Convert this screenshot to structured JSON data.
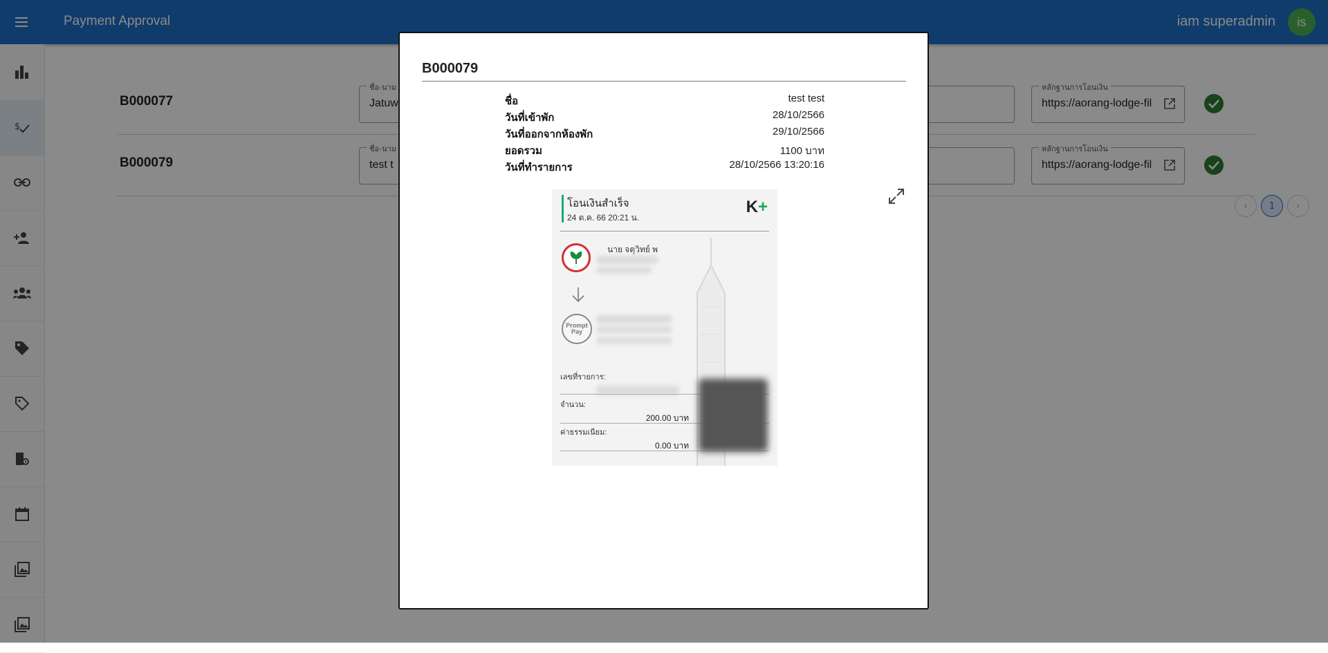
{
  "appbar": {
    "title": "Payment Approval",
    "user_name": "iam superadmin",
    "avatar_initials": "is"
  },
  "sidebar": {
    "items": [
      {
        "icon": "bar-chart-icon",
        "active": false
      },
      {
        "icon": "currency-check-icon",
        "active": true
      },
      {
        "icon": "link-icon",
        "active": false
      },
      {
        "icon": "add-person-icon",
        "active": false
      },
      {
        "icon": "groups-icon",
        "active": false
      },
      {
        "icon": "tag-icon",
        "active": false
      },
      {
        "icon": "tag-outline-icon",
        "active": false
      },
      {
        "icon": "building-settings-icon",
        "active": false
      },
      {
        "icon": "calendar-icon",
        "active": false
      },
      {
        "icon": "image-icon",
        "active": false
      },
      {
        "icon": "image-icon",
        "active": false
      }
    ]
  },
  "rows": [
    {
      "booking_id": "B000077",
      "name_label": "ชื่อ-นาม",
      "name_value": "Jatuw",
      "proof_label": "หลักฐานการโอนเงิน",
      "proof_value": "https://aorang-lodge-fil"
    },
    {
      "booking_id": "B000079",
      "name_label": "ชื่อ-นาม",
      "name_value": "test t",
      "proof_label": "หลักฐานการโอนเงิน",
      "proof_value": "https://aorang-lodge-fil"
    }
  ],
  "pagination": {
    "current_page": "1"
  },
  "dialog": {
    "title": "B000079",
    "details": [
      {
        "label": "ชื่อ",
        "value": "test test"
      },
      {
        "label": "วันที่เข้าพัก",
        "value": "28/10/2566"
      },
      {
        "label": "วันที่ออกจากห้องพัก",
        "value": "29/10/2566"
      },
      {
        "label": "ยอดรวม",
        "value": "1100 บาท"
      },
      {
        "label": "วันที่ทำรายการ",
        "value": "28/10/2566 13:20:16"
      }
    ],
    "slip": {
      "title": "โอนเงินสำเร็จ",
      "date": "24 ต.ค. 66  20:21 น.",
      "logo_text": "K",
      "logo_plus": "+",
      "sender": "นาย จตุวิทย์ พ",
      "promptpay": "Prompt Pay",
      "ref_label": "เลขที่รายการ:",
      "amount_label": "จำนวน:",
      "amount_value": "200.00 บาท",
      "fee_label": "ค่าธรรมเนียม:",
      "fee_value": "0.00 บาท"
    }
  },
  "colors": {
    "appbar": "#1e6fc8",
    "check": "#2e7d32",
    "avatar": "#4caf50"
  }
}
